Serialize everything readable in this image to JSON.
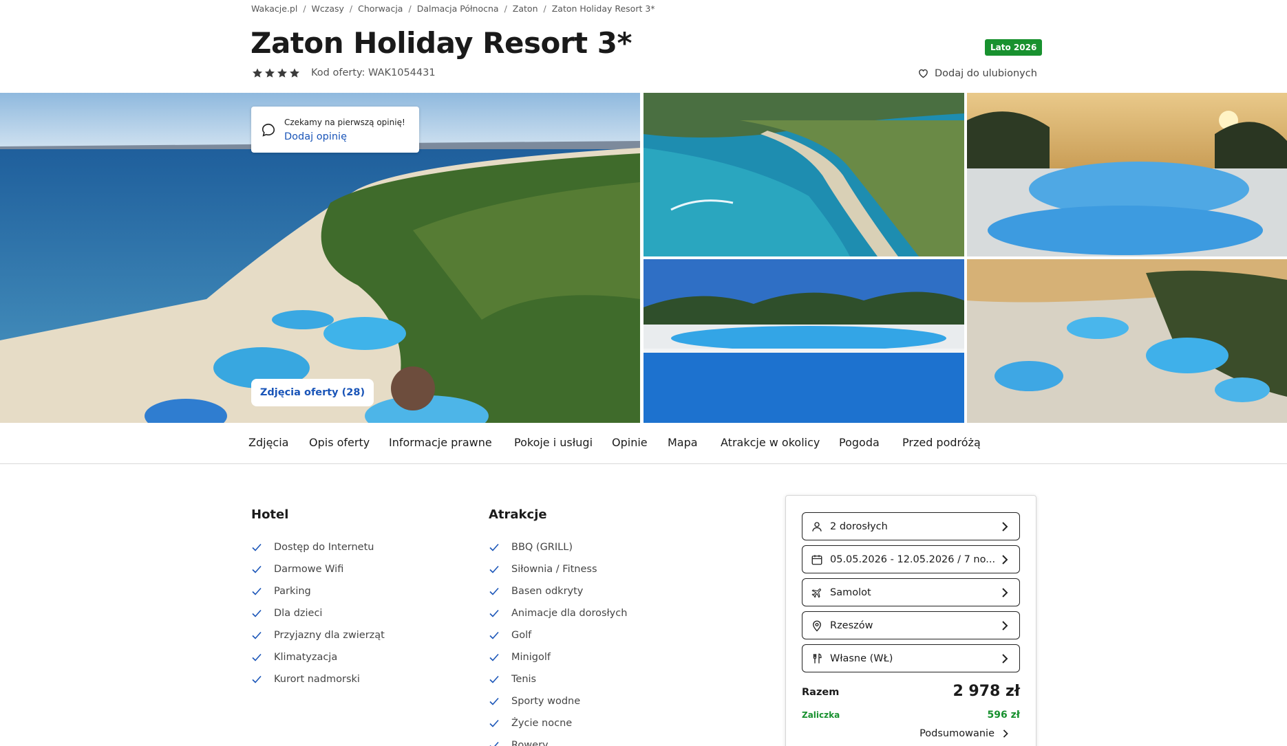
{
  "breadcrumb": [
    "Wakacje.pl",
    "Wczasy",
    "Chorwacja",
    "Dalmacja Północna",
    "Zaton",
    "Zaton Holiday Resort 3*"
  ],
  "hotel": {
    "name": "Zaton Holiday Resort 3*",
    "season_badge": "Lato 2026",
    "stars": 4,
    "offer_code": "Kod oferty: WAK1054431",
    "favorite_label": "Dodaj do ulubionych"
  },
  "review_card": {
    "message": "Czekamy na pierwszą opinię!",
    "action": "Dodaj opinię"
  },
  "gallery": {
    "photos_button": "Zdjęcia oferty (28)"
  },
  "tabs": [
    "Zdjęcia",
    "Opis oferty",
    "Informacje prawne",
    "Pokoje i usługi",
    "Opinie",
    "Mapa",
    "Atrakcje w okolicy",
    "Pogoda",
    "Przed podróżą"
  ],
  "amenities": {
    "hotel_title": "Hotel",
    "hotel_items": [
      "Dostęp do Internetu",
      "Darmowe Wifi",
      "Parking",
      "Dla dzieci",
      "Przyjazny dla zwierząt",
      "Klimatyzacja",
      "Kurort nadmorski"
    ],
    "attractions_title": "Atrakcje",
    "attraction_items": [
      "BBQ (GRILL)",
      "Siłownia / Fitness",
      "Basen odkryty",
      "Animacje dla dorosłych",
      "Golf",
      "Minigolf",
      "Tenis",
      "Sporty wodne",
      "Życie nocne",
      "Rowery"
    ]
  },
  "booking": {
    "travelers": "2 dorosłych",
    "dates": "05.05.2026 - 12.05.2026 / 7 no...",
    "transport": "Samolot",
    "departure": "Rzeszów",
    "board": "Własne (WŁ)",
    "total_label": "Razem",
    "total_value": "2 978 zł",
    "deposit_label": "Zaliczka",
    "deposit_value": "596 zł",
    "summary_label": "Podsumowanie"
  },
  "colors": {
    "accent_blue": "#1a55b8",
    "badge_green": "#18912f",
    "check_blue": "#1a55b8"
  }
}
